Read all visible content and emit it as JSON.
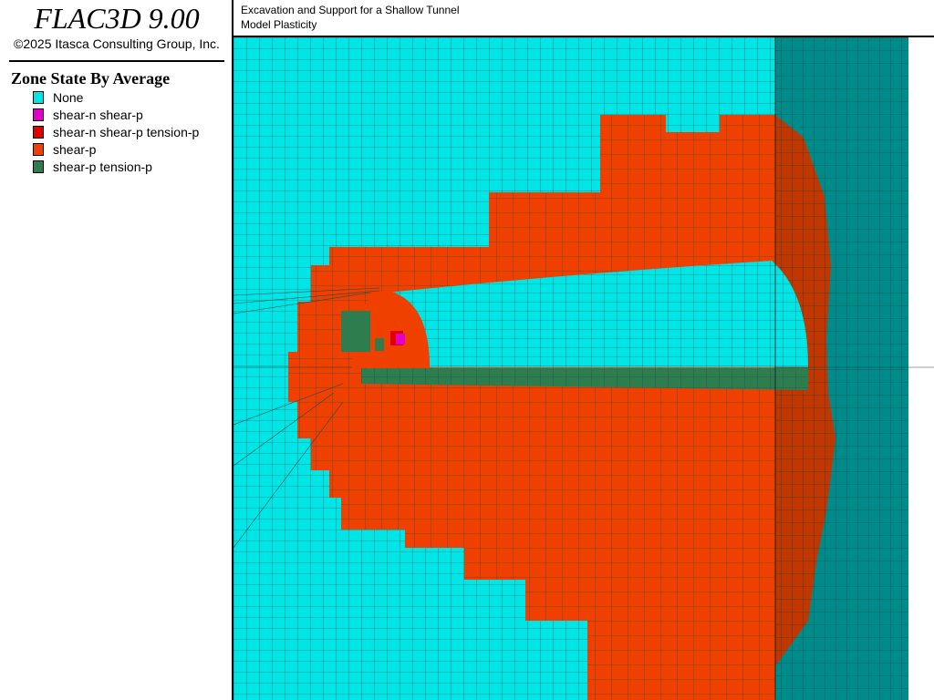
{
  "app": {
    "title": "FLAC3D 9.00",
    "copyright": "©2025 Itasca Consulting Group, Inc."
  },
  "header": {
    "line1": "Excavation and Support for a Shallow Tunnel",
    "line2": "Model Plasticity"
  },
  "legend": {
    "title": "Zone State By Average",
    "items": [
      {
        "label": "None",
        "color": "#00E5E5"
      },
      {
        "label": "shear-n shear-p",
        "color": "#E000C8"
      },
      {
        "label": "shear-n shear-p tension-p",
        "color": "#E00000"
      },
      {
        "label": "shear-p",
        "color": "#F04000"
      },
      {
        "label": "shear-p tension-p",
        "color": "#2E7D4F"
      }
    ]
  },
  "colors": {
    "none": "#00E5E5",
    "none_dark": "#008B8B",
    "shear_p": "#F04000",
    "shear_p_dark": "#C03800",
    "tension": "#2E7D4F",
    "mesh": "#1A4A4A"
  }
}
